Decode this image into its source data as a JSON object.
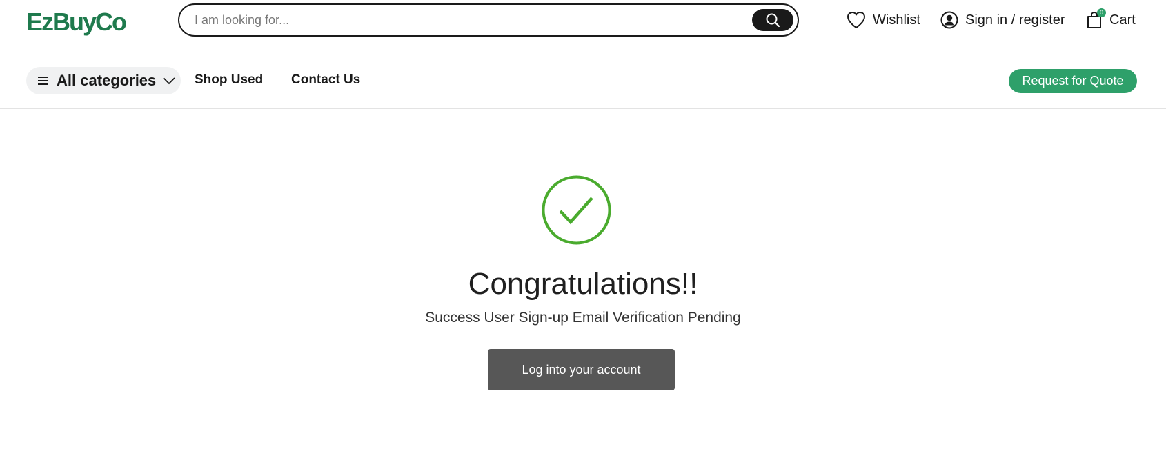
{
  "header": {
    "logo_text": "EzBuyCo",
    "search": {
      "placeholder": "I am looking for..."
    },
    "wishlist_label": "Wishlist",
    "signin_label": "Sign in / register",
    "cart_label": "Cart",
    "cart_count": "0"
  },
  "nav": {
    "all_categories_label": "All categories",
    "links": [
      {
        "label": "Shop Used"
      },
      {
        "label": "Contact Us"
      }
    ],
    "quote_button_label": "Request for Quote"
  },
  "main": {
    "title": "Congratulations!!",
    "subtitle": "Success User Sign-up Email Verification Pending",
    "login_button_label": "Log into your account"
  },
  "colors": {
    "brand_green": "#1f7a4d",
    "accent_green": "#2ea06a",
    "check_green": "#4aab2e",
    "button_gray": "#575757"
  },
  "icons": {
    "search": "search-icon",
    "wishlist": "heart-icon",
    "account": "user-circle-icon",
    "cart": "shopping-bag-icon",
    "menu": "hamburger-icon",
    "dropdown": "chevron-down-icon",
    "success": "check-circle-icon"
  }
}
